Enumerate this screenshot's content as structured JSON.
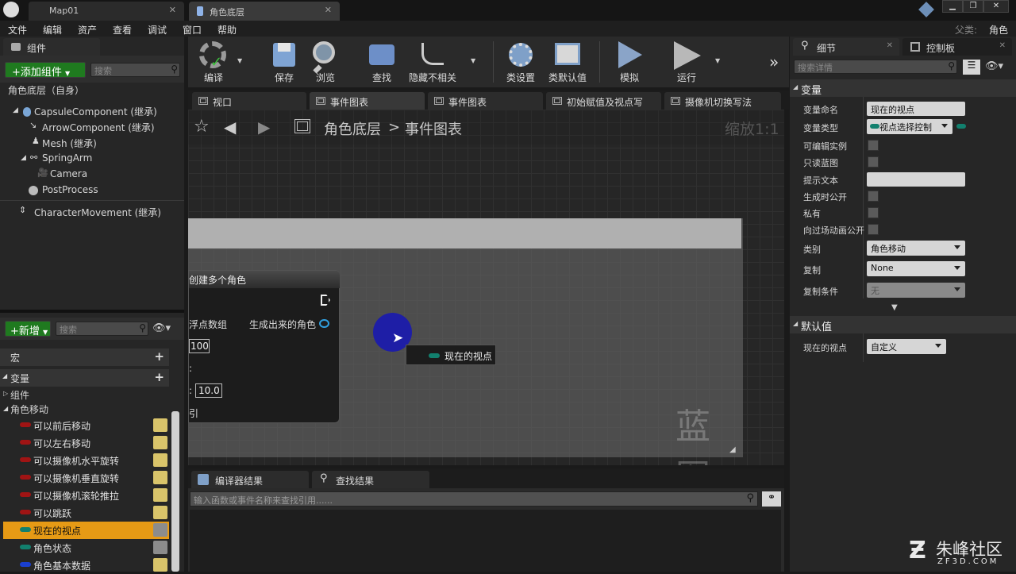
{
  "title_tabs": [
    {
      "label": "Map01"
    },
    {
      "label": "角色底层"
    }
  ],
  "parent_class": {
    "label": "父类:",
    "value": "角色"
  },
  "menu": [
    "文件",
    "编辑",
    "资产",
    "查看",
    "调试",
    "窗口",
    "帮助"
  ],
  "components_panel": {
    "tab": "组件",
    "add_button": "+添加组件",
    "search_placeholder": "搜索",
    "root": "角色底层（自身）",
    "tree": [
      "CapsuleComponent (继承)",
      "ArrowComponent (继承)",
      "Mesh (继承)",
      "SpringArm",
      "Camera",
      "PostProcess",
      "CharacterMovement (继承)"
    ]
  },
  "my_blueprint": {
    "new_button": "+新增",
    "search_placeholder": "搜索",
    "sections": {
      "macros": "宏",
      "variables": "变量",
      "components": "组件",
      "category": "角色移动"
    },
    "variables": [
      {
        "name": "可以前后移动",
        "color": "#a01414",
        "selected": false,
        "eye": true
      },
      {
        "name": "可以左右移动",
        "color": "#a01414",
        "selected": false,
        "eye": true
      },
      {
        "name": "可以摄像机水平旋转",
        "color": "#a01414",
        "selected": false,
        "eye": true
      },
      {
        "name": "可以摄像机垂直旋转",
        "color": "#a01414",
        "selected": false,
        "eye": true
      },
      {
        "name": "可以摄像机滚轮推拉",
        "color": "#a01414",
        "selected": false,
        "eye": true
      },
      {
        "name": "可以跳跃",
        "color": "#a01414",
        "selected": false,
        "eye": true
      },
      {
        "name": "现在的视点",
        "color": "#12806e",
        "selected": true,
        "eye": false
      },
      {
        "name": "角色状态",
        "color": "#12806e",
        "selected": false,
        "eye": false
      },
      {
        "name": "角色基本数据",
        "color": "#1a3fd0",
        "selected": false,
        "eye": true
      }
    ]
  },
  "toolbar": [
    {
      "label": "编译",
      "icon": "compile-icon"
    },
    {
      "label": "保存",
      "icon": "save-icon"
    },
    {
      "label": "浏览",
      "icon": "browse-icon"
    },
    {
      "label": "查找",
      "icon": "find-icon"
    },
    {
      "label": "隐藏不相关",
      "icon": "hide-unrelated-icon"
    },
    {
      "label": "类设置",
      "icon": "class-settings-icon"
    },
    {
      "label": "类默认值",
      "icon": "class-defaults-icon"
    },
    {
      "label": "模拟",
      "icon": "simulate-icon"
    },
    {
      "label": "运行",
      "icon": "play-icon"
    }
  ],
  "graph_tabs": [
    {
      "label": "视口"
    },
    {
      "label": "事件图表"
    },
    {
      "label": "事件图表"
    },
    {
      "label": "初始赋值及视点写"
    },
    {
      "label": "摄像机切换写法"
    }
  ],
  "breadcrumb": {
    "root": "角色底层",
    "separator": ">",
    "current": "事件图表"
  },
  "zoom": "缩放1:1",
  "node": {
    "title": "创建多个角色",
    "pin_left_1": "浮点数组",
    "pin_right_1": "生成出来的角色",
    "value_1": "100",
    "value_2": "10.0",
    "pin_left_4": "引"
  },
  "tooltip": "现在的视点",
  "watermark": "蓝图",
  "bottom_tabs": [
    {
      "label": "编译器结果"
    },
    {
      "label": "查找结果"
    }
  ],
  "find_placeholder": "输入函数或事件名称来查找引用......",
  "details": {
    "tab_details": "细节",
    "tab_palette": "控制板",
    "search_placeholder": "搜索详情",
    "section_variable": "变量",
    "props": {
      "name_label": "变量命名",
      "name_value": "现在的视点",
      "type_label": "变量类型",
      "type_value": "视点选择控制",
      "editable_label": "可编辑实例",
      "readonly_label": "只读蓝图",
      "tooltip_label": "提示文本",
      "expose_spawn_label": "生成时公开",
      "private_label": "私有",
      "expose_cine_label": "向过场动画公开",
      "category_label": "类别",
      "category_value": "角色移动",
      "replication_label": "复制",
      "replication_value": "None",
      "repcond_label": "复制条件",
      "repcond_value": "无"
    },
    "section_default": "默认值",
    "default_label": "现在的视点",
    "default_value": "自定义"
  },
  "logo": {
    "name": "朱峰社区",
    "url": "ZF3D.COM"
  },
  "colors": {
    "accent_orange": "#e69a15",
    "struct_teal": "#12806e",
    "bool_red": "#a01414",
    "struct_blue": "#1a3fd0"
  }
}
